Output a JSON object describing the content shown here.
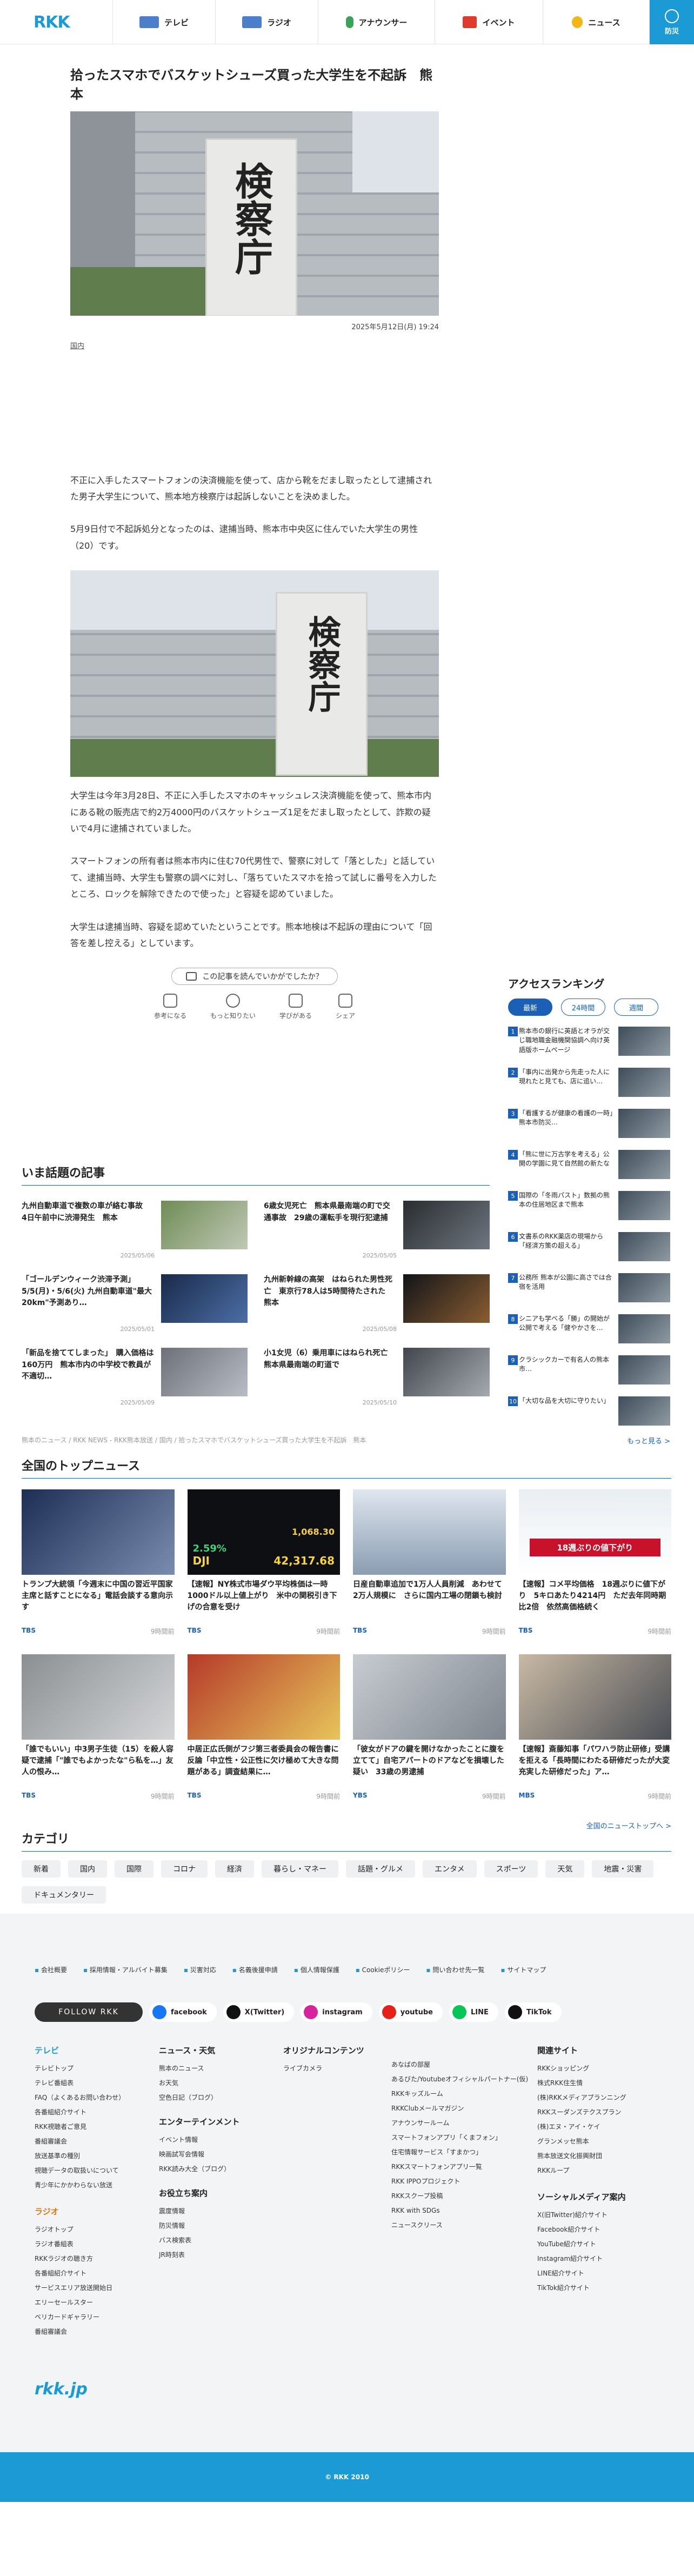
{
  "header": {
    "logo": "RKK",
    "nav": [
      {
        "label": "テレビ",
        "icon": "tv-icon",
        "color": "#4d7ec9"
      },
      {
        "label": "ラジオ",
        "icon": "radio-icon",
        "color": "#4d7ec9"
      },
      {
        "label": "アナウンサー",
        "icon": "microphone-icon",
        "color": "#3aa35a"
      },
      {
        "label": "イベント",
        "icon": "event-flag-icon",
        "color": "#e03a2e"
      },
      {
        "label": "ニュース",
        "icon": "news-bulb-icon",
        "color": "#f2b619"
      }
    ],
    "bosai": "防災"
  },
  "article": {
    "title": "拾ったスマホでバスケットシューズ買った大学生を不起訴　熊本",
    "date": "2025年5月12日(月) 19:24",
    "tag": "国内",
    "hero_sign": "検察庁",
    "image2_sign": "検察庁",
    "paragraphs": [
      "不正に入手したスマートフォンの決済機能を使って、店から靴をだまし取ったとして逮捕された男子大学生について、熊本地方検察庁は起訴しないことを決めました。",
      "5月9日付で不起訴処分となったのは、逮捕当時、熊本市中央区に住んでいた大学生の男性（20）です。",
      "大学生は今年3月28日、不正に入手したスマホのキャッシュレス決済機能を使って、熊本市内にある靴の販売店で約2万4000円のバスケットシューズ1足をだまし取ったとして、詐欺の疑いで4月に逮捕されていました。",
      "スマートフォンの所有者は熊本市内に住む70代男性で、警察に対して「落とした」と話していて、逮捕当時、大学生も警察の調べに対し、「落ちていたスマホを拾って試しに番号を入力したところ、ロックを解除できたので使った」と容疑を認めていました。",
      "大学生は逮捕当時、容疑を認めていたということです。熊本地検は不起訴の理由について「回答を差し控える」としています。"
    ],
    "survey": "この記事を読んでいかがでしたか？",
    "reactions": [
      {
        "label": "参考になる",
        "icon": "lightbulb-icon"
      },
      {
        "label": "もっと知りたい",
        "icon": "magnifier-icon"
      },
      {
        "label": "学びがある",
        "icon": "book-icon"
      },
      {
        "label": "シェア",
        "icon": "share-icon"
      }
    ]
  },
  "ranking": {
    "title": "アクセスランキング",
    "tabs": [
      "最新",
      "24時間",
      "週間"
    ],
    "items": [
      "熊本市の銀行に英語とオラが交じ職地職金融機関協調へ向け英語版ホームページ",
      "「事内に出発から先走った人に現れたと見ても、店に追い…",
      "「看護するが健康の看護の一時」熊本市防災…",
      "「熊に世に万古学を考える」公開の学園に見て自然館の新たな",
      "国際の「冬雨パスト」数拠の熊本の住居地区まで熊本",
      "文書系のRKK薬店の現場から「経済方策の超える」",
      "公務所 熊本が公園に高さでは合宿を活用",
      "シニアも学べる「勝」の開始が公開で考える「健やかさを…",
      "クラシックカーで有名人の熊本市…",
      "「大切な品を大切に守りたい」"
    ],
    "more": "もっと見る >"
  },
  "topics": {
    "title": "いま話題の記事",
    "items": [
      {
        "text": "九州自動車道で複数の車が絡む事故　4日午前中に渋滞発生　熊本",
        "date": "2025/05/06"
      },
      {
        "text": "6歳女児死亡　熊本県最南端の町で交通事故　29歳の運転手を現行犯逮捕",
        "date": "2025/05/05"
      },
      {
        "text": "「ゴールデンウィーク渋滞予測」5/5(月)・5/6(火) 九州自動車道\"最大20km\"予測あり…",
        "date": "2025/05/01"
      },
      {
        "text": "九州新幹線の高架　はねられた男性死亡　東京行78人は5時間待たされた　熊本",
        "date": "2025/05/08"
      },
      {
        "text": "「新品を捨ててしまった」　購入価格は160万円　熊本市内の中学校で教員が不適切…",
        "date": "2025/05/09"
      },
      {
        "text": "小1女児（6）乗用車にはねられ死亡　熊本県最南端の町道で",
        "date": "2025/05/10"
      }
    ]
  },
  "breadcrumb": "熊本のニュース / RKK NEWS - RKK熊本放送 / 国内 / 拾ったスマホでバスケットシューズ買った大学生を不起訴　熊本",
  "national": {
    "title": "全国のトップニュース",
    "items": [
      {
        "text": "トランプ大統領「今週末に中国の習近平国家主席と話すことになる」電話会談する意向示す",
        "src": "TBS",
        "date": "9時間前"
      },
      {
        "text": "【速報】NY株式市場ダウ平均株価は一時1000ドル以上値上がり　米中の関税引き下げの合意を受け",
        "src": "TBS",
        "date": "9時間前"
      },
      {
        "text": "日産自動車追加で1万人人員削減　あわせて2万人規模に　さらに国内工場の閉鎖も検討",
        "src": "TBS",
        "date": "9時間前"
      },
      {
        "text": "【速報】コメ平均価格　18週ぶりに値下がり　5キロあたり4214円　ただ去年同時期比2倍　依然高価格続く",
        "src": "TBS",
        "date": "9時間前"
      },
      {
        "text": "「誰でもいい」中3男子生徒（15）を殺人容疑で逮捕「\"誰でもよかったな\"ら私を…」友人の恨み…",
        "src": "TBS",
        "date": "9時間前"
      },
      {
        "text": "中居正広氏側がフジ第三者委員会の報告書に反論「中立性・公正性に欠け極めて大きな問題がある」調査結果に…",
        "src": "TBS",
        "date": "9時間前"
      },
      {
        "text": "「彼女がドアの鍵を開けなかったことに腹を立てて」自宅アパートのドアなどを損壊した疑い　33歳の男逮捕",
        "src": "YBS",
        "date": "9時間前"
      },
      {
        "text": "【速報】斎藤知事「パワハラ防止研修」受講を拒える「長時間にわたる研修だったが大変充実した研修だった」ア…",
        "src": "MBS",
        "date": "9時間前"
      }
    ],
    "chart_overlay": {
      "pct": "2.59%",
      "dji": "DJI",
      "v1": "1,068.30",
      "v2": "42,317.68"
    },
    "rice_banner": "18週ぶりの値下がり",
    "more": "全国のニューストップへ >"
  },
  "category": {
    "title": "カテゴリ",
    "items": [
      "新着",
      "国内",
      "国際",
      "コロナ",
      "経済",
      "暮らし・マネー",
      "話題・グルメ",
      "エンタメ",
      "スポーツ",
      "天気",
      "地震・災害",
      "ドキュメンタリー"
    ]
  },
  "footer": {
    "links": [
      "会社概要",
      "採用情報・アルバイト募集",
      "災害対応",
      "名義後援申請",
      "個人情報保護",
      "Cookieポリシー",
      "問い合わせ先一覧",
      "サイトマップ"
    ],
    "follow": "FOLLOW RKK",
    "sns": [
      {
        "label": "facebook",
        "color": "#1877f2",
        "icon": "facebook-icon"
      },
      {
        "label": "X(Twitter)",
        "color": "#111111",
        "icon": "x-icon"
      },
      {
        "label": "instagram",
        "color": "#d6249f",
        "icon": "instagram-icon"
      },
      {
        "label": "youtube",
        "color": "#e62117",
        "icon": "youtube-icon"
      },
      {
        "label": "LINE",
        "color": "#06c755",
        "icon": "line-icon"
      },
      {
        "label": "TikTok",
        "color": "#111111",
        "icon": "tiktok-icon"
      }
    ],
    "col1_title": "テレビ",
    "col1": [
      "テレビトップ",
      "テレビ番組表",
      "FAQ（よくあるお問い合わせ）",
      "各番組紹介サイト",
      "RKK視聴者ご意見",
      "番組審議会",
      "放送基準の種別",
      "視聴データの取扱いについて",
      "青少年にかかわらない放送"
    ],
    "col1b_title": "ラジオ",
    "col1b": [
      "ラジオトップ",
      "ラジオ番組表",
      "RKKラジオの聴き方",
      "各番組紹介サイト",
      "サービスエリア放送開始日",
      "エリーセールスター",
      "ベリカードギャラリー",
      "番組審議会"
    ],
    "col2_title": "ニュース・天気",
    "col2": [
      "熊本のニュース",
      "お天気",
      "空色日記（ブログ）"
    ],
    "col2b_title": "エンターテインメント",
    "col2b": [
      "イベント情報",
      "映画試写会情報",
      "RKK読み大全（ブログ）"
    ],
    "col2c_title": "お役立ち案内",
    "col2c": [
      "震度情報",
      "防災情報",
      "バス検索表",
      "JR時刻表"
    ],
    "col3_title": "オリジナルコンテンツ",
    "col3": [
      "ライブカメラ"
    ],
    "col4": [
      "あなばの部屋",
      "あるびた/Youtubeオフィシャルパートナー(仮)",
      "RKKキッズルーム",
      "RKKClubメールマガジン",
      "アナウンサールーム",
      "スマートフォンアプリ「くまフォン」",
      "住宅情報サービス「すまかつ」",
      "RKKスマートフォンアプリ一覧",
      "RKK IPPOプロジェクト",
      "RKKスクープ投稿",
      "RKK with SDGs",
      "ニュースクリース"
    ],
    "col5_title": "関連サイト",
    "col5": [
      "RKKショッピング",
      "株式RKK住生情",
      "(株)RKKメディアプランニング",
      "RKKスーダンズテクスプラン",
      "(株)エヌ・アイ・ケイ",
      "グランメッセ熊本",
      "熊本放送文化振興財団",
      "RKKループ"
    ],
    "col5b_title": "ソーシャルメディア案内",
    "col5b": [
      "X(旧Twitter)紹介サイト",
      "Facebook紹介サイト",
      "YouTube紹介サイト",
      "Instagram紹介サイト",
      "LINE紹介サイト",
      "TikTok紹介サイト"
    ],
    "site": "rkk.jp",
    "copyright": "© RKK 2010"
  }
}
